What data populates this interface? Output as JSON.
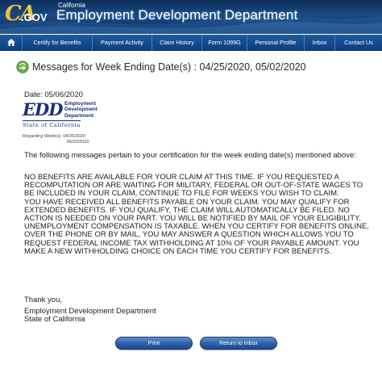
{
  "header": {
    "logo_ca": "CA",
    "logo_gov": ".GOV",
    "state_label": "California",
    "agency_name": "Employment Development Department"
  },
  "nav": {
    "items": [
      {
        "label": "Certify for Benefits"
      },
      {
        "label": "Payment Activity"
      },
      {
        "label": "Claim History"
      },
      {
        "label": "Form 1099G"
      },
      {
        "label": "Personal Profile"
      },
      {
        "label": "Inbox"
      },
      {
        "label": "Contact Us"
      }
    ]
  },
  "page": {
    "title": "Messages for Week Ending Date(s) : 04/25/2020, 05/02/2020",
    "date_line": "Date: 05/06/2020",
    "edd_letters": "EDD",
    "edd_line1": "Employment",
    "edd_line2": "Development",
    "edd_line3": "Department",
    "edd_state": "State of California",
    "regarding_label": "Regarding Week(s): 04/25/2020",
    "regarding_week2": "05/02/2020",
    "intro": "The following messages pertain to your certification for the week ending date(s) mentioned above:",
    "messages": [
      "NO BENEFITS ARE AVAILABLE FOR YOUR CLAIM AT THIS TIME. IF YOU REQUESTED A RECOMPUTATION OR ARE WAITING FOR MILITARY, FEDERAL OR OUT-OF-STATE WAGES TO BE INCLUDED IN YOUR CLAIM, CONTINUE TO FILE FOR WEEKS YOU WISH TO CLAIM.",
      "YOU HAVE RECEIVED ALL BENEFITS PAYABLE ON YOUR CLAIM.  YOU MAY QUALIFY FOR EXTENDED BENEFITS. IF YOU QUALIFY, THE CLAIM WILL AUTOMATICALLY BE FILED. NO ACTION IS NEEDED ON YOUR PART. YOU WILL BE NOTIFIED BY MAIL OF YOUR ELIGIBILITY.",
      "UNEMPLOYMENT COMPENSATION IS TAXABLE.  WHEN YOU CERTIFY FOR BENEFITS ONLINE, OVER THE PHONE OR BY MAIL, YOU MAY ANSWER A QUESTION WHICH ALLOWS YOU TO REQUEST FEDERAL INCOME TAX WITHHOLDING AT 10% OF YOUR PAYABLE AMOUNT.  YOU MAKE A NEW WITHHOLDING CHOICE ON EACH TIME YOU CERTIFY FOR BENEFITS."
    ],
    "thanks": "Thank you,",
    "signature_line1": "Employment Development Department",
    "signature_line2": "State of California"
  },
  "buttons": {
    "print": "Print",
    "return": "Return to Inbox"
  },
  "colors": {
    "header_bg": "#0d2f5c",
    "nav_bg": "#1c5aa0",
    "button_bg": "#2b5ea6",
    "edd_blue": "#1a2f7a"
  }
}
